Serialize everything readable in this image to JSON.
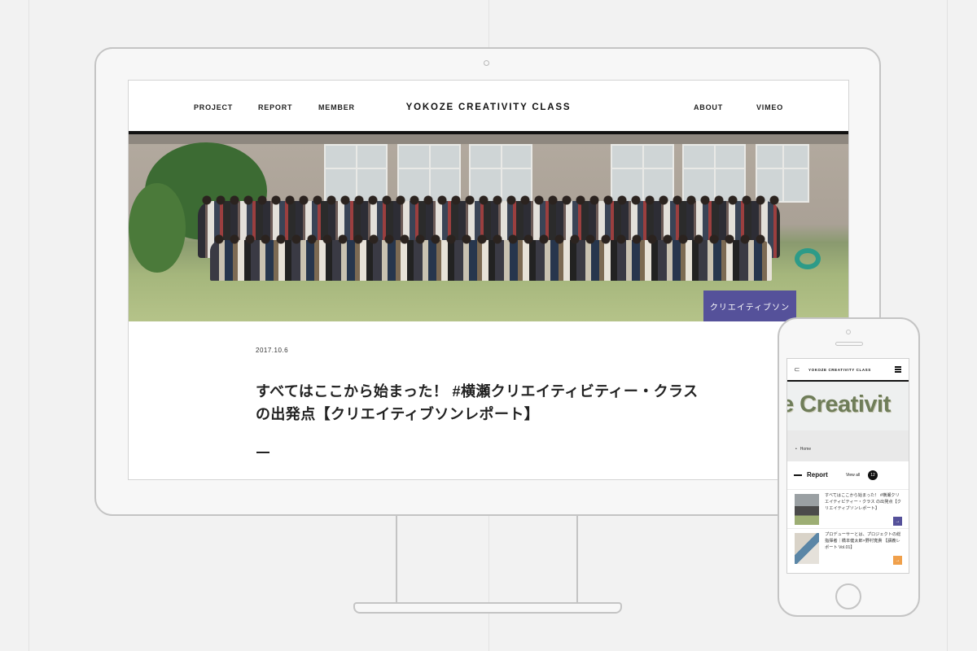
{
  "colors": {
    "background": "#f2f2f2",
    "accent_purple": "#55519a",
    "accent_orange": "#f0a04b",
    "nav_rule": "#111111"
  },
  "desktop": {
    "nav": {
      "left_links": [
        "PROJECT",
        "REPORT",
        "MEMBER"
      ],
      "logo": "YOKOZE CREATIVITY CLASS",
      "right_links": [
        "ABOUT",
        "VIMEO"
      ]
    },
    "category_badge": "クリエイティブソン",
    "post": {
      "date": "2017.10.6",
      "title_line1": "すべてはここから始まった！ #横瀬クリエイティビティー・クラス",
      "title_line2": "の出発点【クリエイティブソンレポート】"
    }
  },
  "mobile": {
    "back_icon": "parenthesis-back-icon",
    "logo": "YOKOZE CREATIVITY CLASS",
    "menu_icon": "hamburger-menu-icon",
    "hero_text": "ze Creativit",
    "breadcrumb": "Home",
    "section_title": "Report",
    "view_all": "View all",
    "count": "12",
    "items": [
      {
        "title": "すべてはここから始まった！ #横瀬クリエイティビティー・クラス の出発点【クリエイティブソンレポート】",
        "arrow": "→",
        "arrow_color": "#55519a"
      },
      {
        "title": "プロデューサーとは、プロジェクトの総指揮者｜橋本健太郎×野村寛貴 【講義レポート Vol.01】",
        "arrow": "→",
        "arrow_color": "#f0a04b"
      }
    ]
  }
}
